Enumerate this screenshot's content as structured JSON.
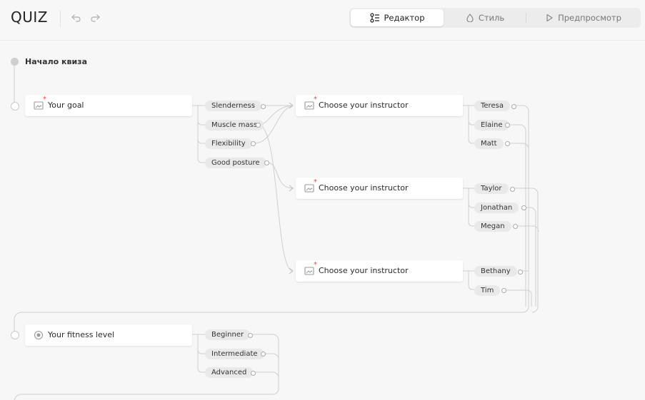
{
  "app": {
    "title": "QUIZ"
  },
  "toolbar": {
    "undo_icon": "undo-arrow-icon",
    "redo_icon": "redo-arrow-icon",
    "modes": [
      {
        "label": "Редактор",
        "icon": "editor-list-icon",
        "active": true
      },
      {
        "label": "Стиль",
        "icon": "drop-icon",
        "active": false
      },
      {
        "label": "Предпросмотр",
        "icon": "play-icon",
        "active": false
      }
    ]
  },
  "flow": {
    "start_label": "Начало квиза",
    "questions": [
      {
        "title": "Your goal",
        "type_icon": "image-icon",
        "required": true,
        "options": [
          "Slenderness",
          "Muscle mass",
          "Flexibility",
          "Good posture"
        ]
      },
      {
        "title": "Choose your instructor",
        "type_icon": "image-icon",
        "required": true,
        "options": [
          "Teresa",
          "Elaine",
          "Matt"
        ]
      },
      {
        "title": "Choose your instructor",
        "type_icon": "image-icon",
        "required": true,
        "options": [
          "Taylor",
          "Jonathan",
          "Megan"
        ]
      },
      {
        "title": "Choose your instructor",
        "type_icon": "image-icon",
        "required": true,
        "options": [
          "Bethany",
          "Tim"
        ]
      },
      {
        "title": "Your fitness level",
        "type_icon": "radio-icon",
        "required": false,
        "options": [
          "Beginner",
          "Intermediate",
          "Advanced"
        ]
      }
    ]
  },
  "colors": {
    "background": "#f7f7f7",
    "card": "#ffffff",
    "option_pill": "#e9e9e9",
    "wire": "#cfcfcf",
    "required_mark": "#e0463f"
  }
}
